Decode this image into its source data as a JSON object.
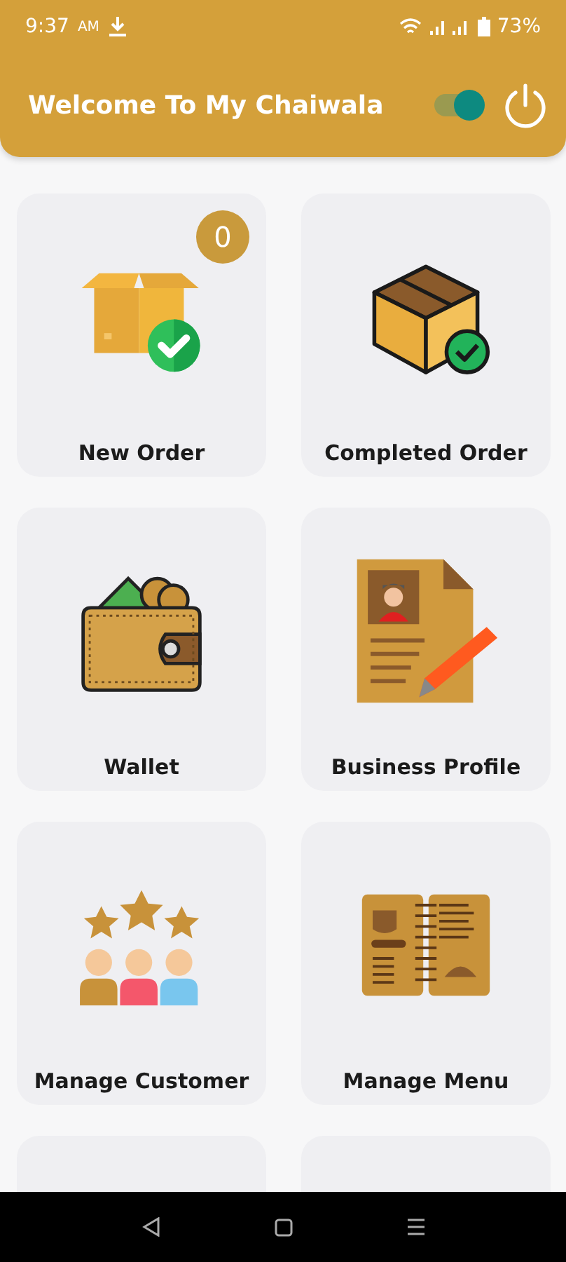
{
  "status_bar": {
    "time": "9:37",
    "meridiem": "AM",
    "battery": "73%"
  },
  "header": {
    "title": "Welcome To My Chaiwala",
    "toggle": {
      "on": true
    }
  },
  "tiles": [
    {
      "kind": "new_order",
      "label": "New Order",
      "badge": "0"
    },
    {
      "kind": "completed_order",
      "label": "Completed Order"
    },
    {
      "kind": "wallet",
      "label": "Wallet"
    },
    {
      "kind": "business_profile",
      "label": "Business Profile"
    },
    {
      "kind": "customers",
      "label": "Manage Customer"
    },
    {
      "kind": "menu",
      "label": "Manage Menu"
    }
  ]
}
